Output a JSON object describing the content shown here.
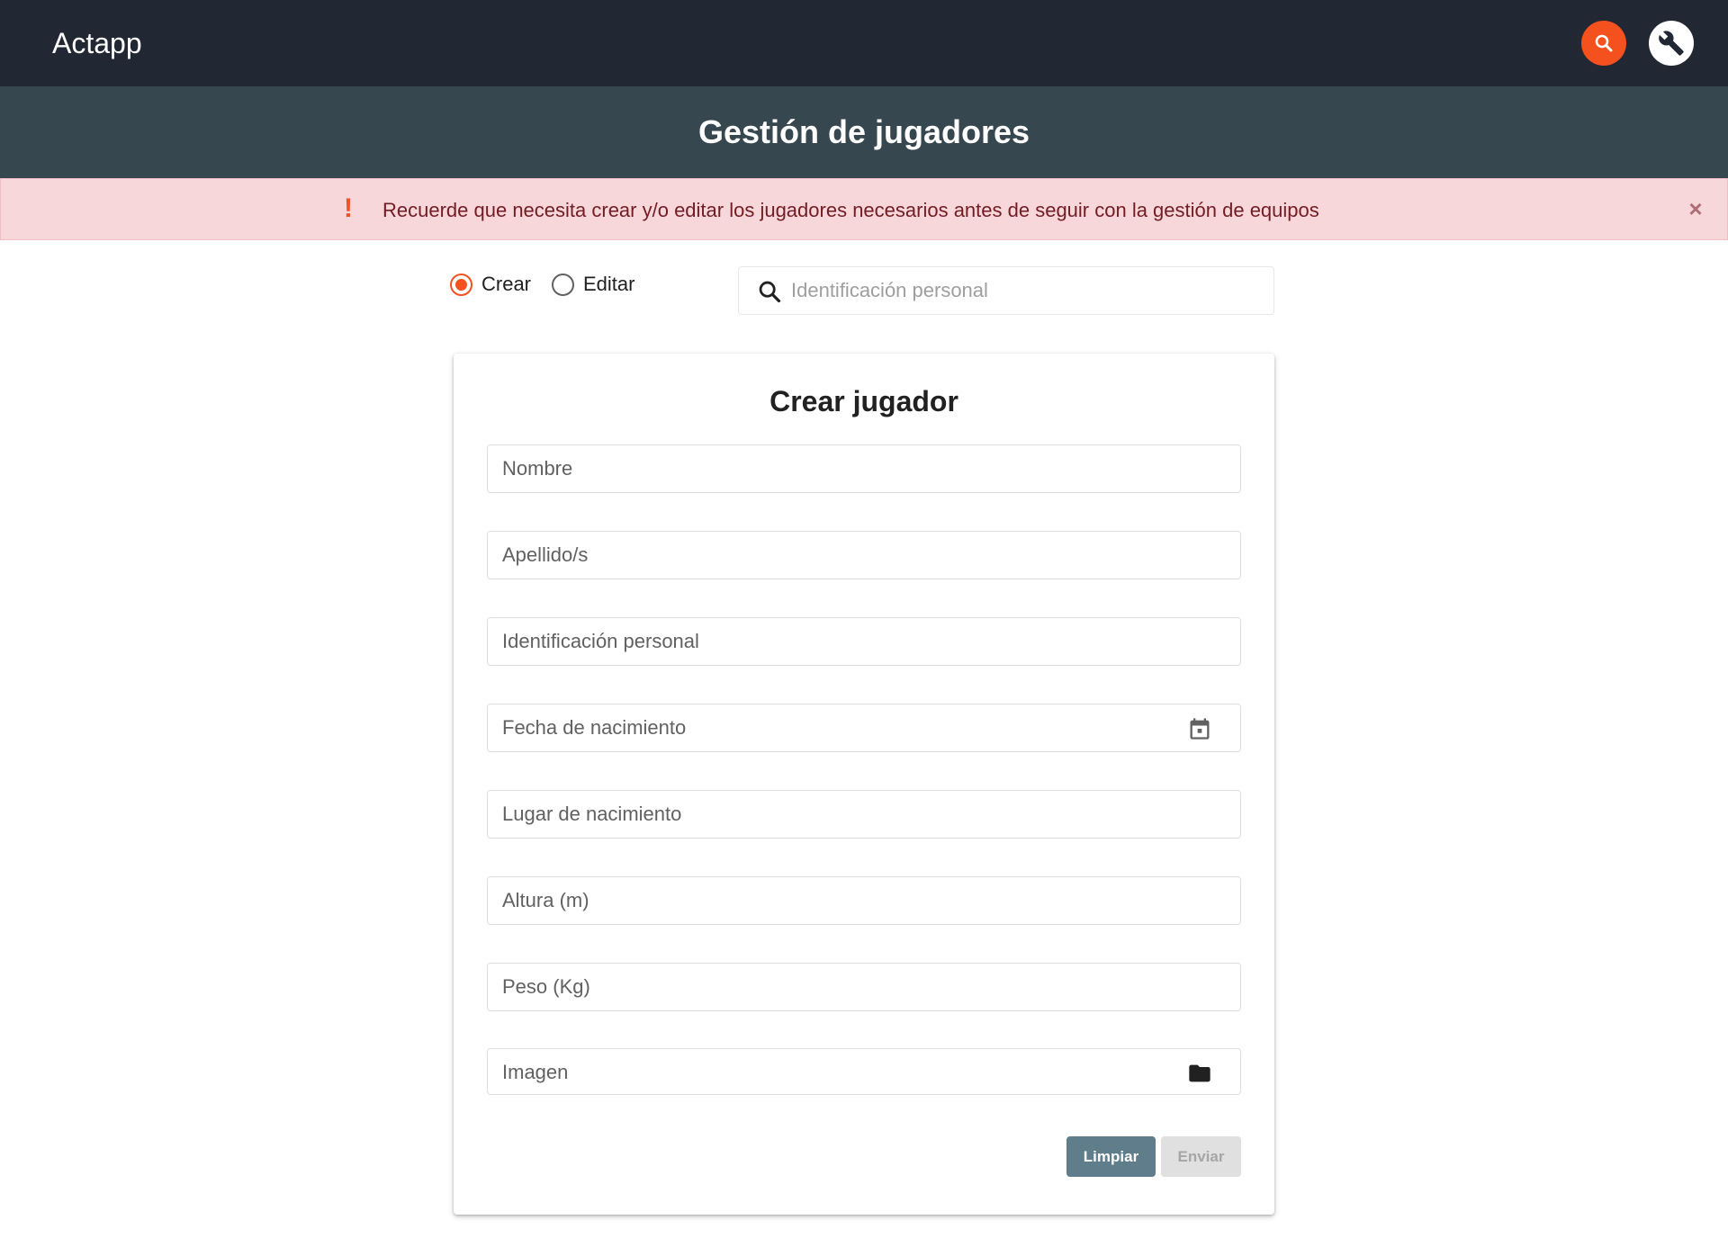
{
  "app": {
    "name": "Actapp"
  },
  "header": {
    "search_icon": "search-icon",
    "tools_icon": "wrench-icon",
    "accent": "#f4511e",
    "bar_color": "#212833"
  },
  "page": {
    "title": "Gestión de jugadores",
    "title_bar_color": "#37474f"
  },
  "alert": {
    "icon": "!",
    "message": "Recuerde que necesita crear y/o editar los jugadores necesarios antes de seguir con la gestión de equipos",
    "close": "×",
    "background": "#f8d7da"
  },
  "mode": {
    "options": [
      {
        "label": "Crear",
        "checked": true
      },
      {
        "label": "Editar",
        "checked": false
      }
    ]
  },
  "search": {
    "placeholder": "Identificación personal"
  },
  "form": {
    "title": "Crear jugador",
    "fields": [
      {
        "placeholder": "Nombre"
      },
      {
        "placeholder": "Apellido/s"
      },
      {
        "placeholder": "Identificación personal"
      },
      {
        "placeholder": "Fecha de nacimiento",
        "icon": "calendar-icon"
      },
      {
        "placeholder": "Lugar de nacimiento"
      },
      {
        "placeholder": "Altura (m)"
      },
      {
        "placeholder": "Peso (Kg)"
      },
      {
        "placeholder": "Imagen",
        "icon": "folder-icon"
      }
    ],
    "buttons": {
      "clear": "Limpiar",
      "send": "Enviar",
      "send_disabled": true
    }
  }
}
